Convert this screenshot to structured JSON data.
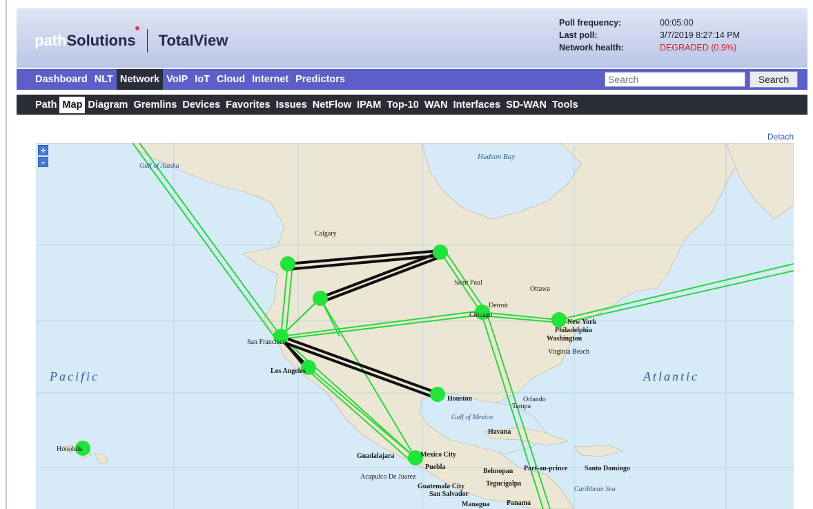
{
  "header": {
    "brand_prefix": "path",
    "brand_main": "Solutions",
    "product": "TotalView",
    "status": [
      {
        "label": "Poll frequency:",
        "value": "00:05:00"
      },
      {
        "label": "Last poll:",
        "value": "3/7/2019 8:27:14 PM"
      },
      {
        "label": "Network health:",
        "value": "DEGRADED (0.9%)"
      }
    ]
  },
  "nav_primary": {
    "items": [
      "Dashboard",
      "NLT",
      "Network",
      "VoIP",
      "IoT",
      "Cloud",
      "Internet",
      "Predictors"
    ],
    "active": "Network",
    "search_placeholder": "Search",
    "search_button": "Search"
  },
  "nav_secondary": {
    "items": [
      "Path",
      "Map",
      "Diagram",
      "Gremlins",
      "Devices",
      "Favorites",
      "Issues",
      "NetFlow",
      "IPAM",
      "Top-10",
      "WAN",
      "Interfaces",
      "SD-WAN",
      "Tools"
    ],
    "active": "Map"
  },
  "detach_label": "Detach",
  "map": {
    "zoom_in": "+",
    "zoom_out": "-",
    "oceans": {
      "pacific": "Pacific",
      "atlantic": "Atlantic",
      "hudson": "Hudson Bay",
      "alaska": "Gulf of Alaska",
      "gulf": "Gulf of Mexico",
      "caribbean": "Caribbean Sea"
    },
    "cities": [
      "Houston",
      "Philadelphia",
      "Washington",
      "New York",
      "Los Angeles",
      "San Francisco",
      "Havana",
      "Guadalajara",
      "Mexico City",
      "Puebla",
      "Belmopan",
      "Guatemala City",
      "San Salvador",
      "Tegucigalpa",
      "Managua",
      "Panama",
      "Santo Domingo",
      "Port-au-prince",
      "Honolulu",
      "Calgary",
      "Saint Paul",
      "Ottawa",
      "Detroit",
      "Chicago",
      "Orlando",
      "Tampa",
      "Virginia Beach",
      "Acapulco De Juarez"
    ],
    "colors": {
      "node": "#22e33a",
      "wan_link": "#28c83a",
      "trunk_link": "#111111",
      "land": "#efe9d8",
      "water": "#d6eaf7"
    }
  }
}
